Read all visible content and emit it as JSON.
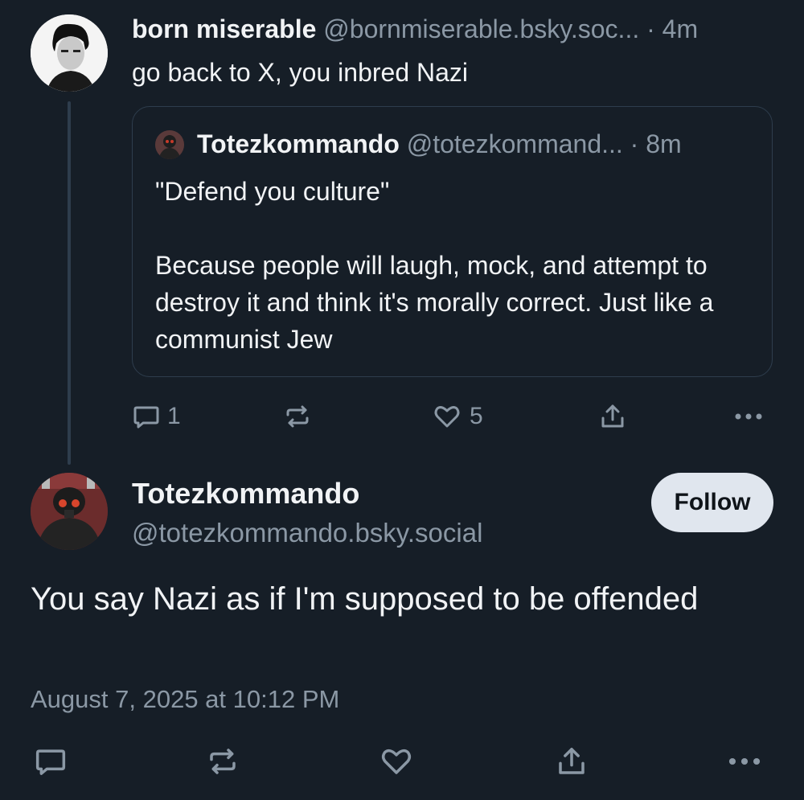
{
  "parent_post": {
    "display_name": "born miserable",
    "handle": "@bornmiserable.bsky.soc...",
    "time": "· 4m",
    "text": "go back to X, you inbred Nazi",
    "quote": {
      "display_name": "Totezkommando",
      "handle": "@totezkommand...",
      "time": "· 8m",
      "paragraph1": "\"Defend you culture\"",
      "paragraph2": "Because people will laugh, mock, and attempt to destroy it and think it's morally correct. Just like a communist Jew"
    },
    "actions": {
      "reply_count": "1",
      "like_count": "5"
    }
  },
  "main_post": {
    "display_name": "Totezkommando",
    "handle": "@totezkommando.bsky.social",
    "follow_label": "Follow",
    "text": "You say Nazi as if I'm supposed to be offended",
    "timestamp": "August 7, 2025 at 10:12 PM"
  },
  "icons": [
    "reply-icon",
    "repost-icon",
    "like-icon",
    "share-icon",
    "more-icon"
  ],
  "colors": {
    "background": "#161e27",
    "text_primary": "#f1f3f5",
    "text_muted": "#8b98a5",
    "border": "#2e3d4d",
    "follow_button_bg": "#e0e6ee"
  }
}
